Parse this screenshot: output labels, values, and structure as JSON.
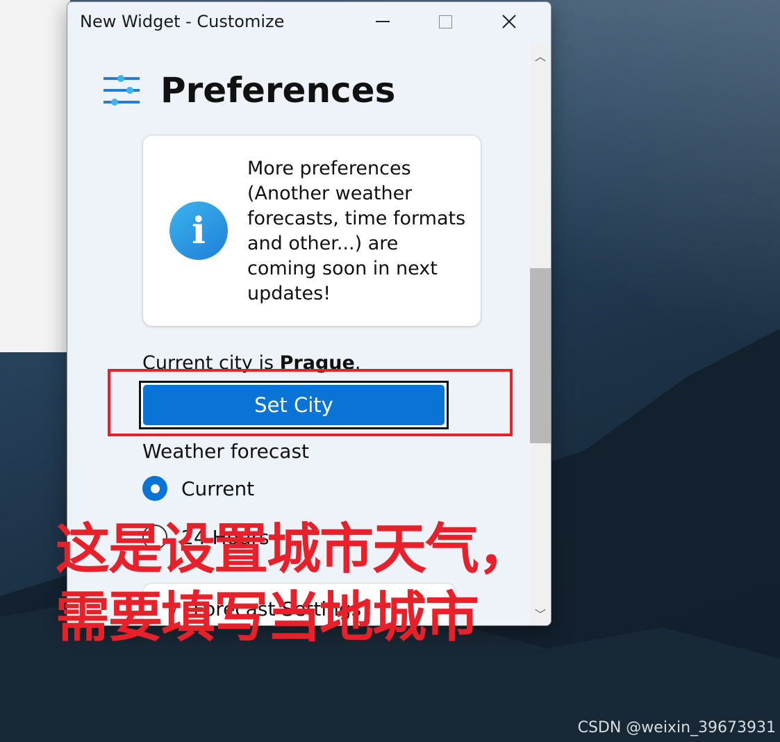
{
  "window": {
    "title": "New Widget - Customize",
    "minimize_glyph": "",
    "maximize_glyph": "",
    "close_glyph": "✕"
  },
  "preferences": {
    "title": "Preferences",
    "icon": "sliders-icon"
  },
  "info_card": {
    "icon": "info-icon",
    "icon_glyph": "i",
    "text": "More preferences (Another weather forecasts, time formats and other...) are coming soon in next updates!"
  },
  "city": {
    "prefix": "Current city is ",
    "name": "Prague",
    "suffix": ".",
    "button_label": "Set City"
  },
  "weather_forecast": {
    "label": "Weather forecast",
    "options": [
      {
        "label": "Current",
        "selected": true
      },
      {
        "label": "24 Hours",
        "selected": false
      }
    ]
  },
  "forecast_settings": {
    "label": "Forecast Settings",
    "chevron": "∨"
  },
  "annotation": {
    "line1": "这是设置城市天气，",
    "line2": "需要填写当地城市",
    "color": "#e8202a"
  },
  "scrollbar": {
    "up": "︿",
    "down": "﹀"
  },
  "watermark": "CSDN @weixin_39673931"
}
